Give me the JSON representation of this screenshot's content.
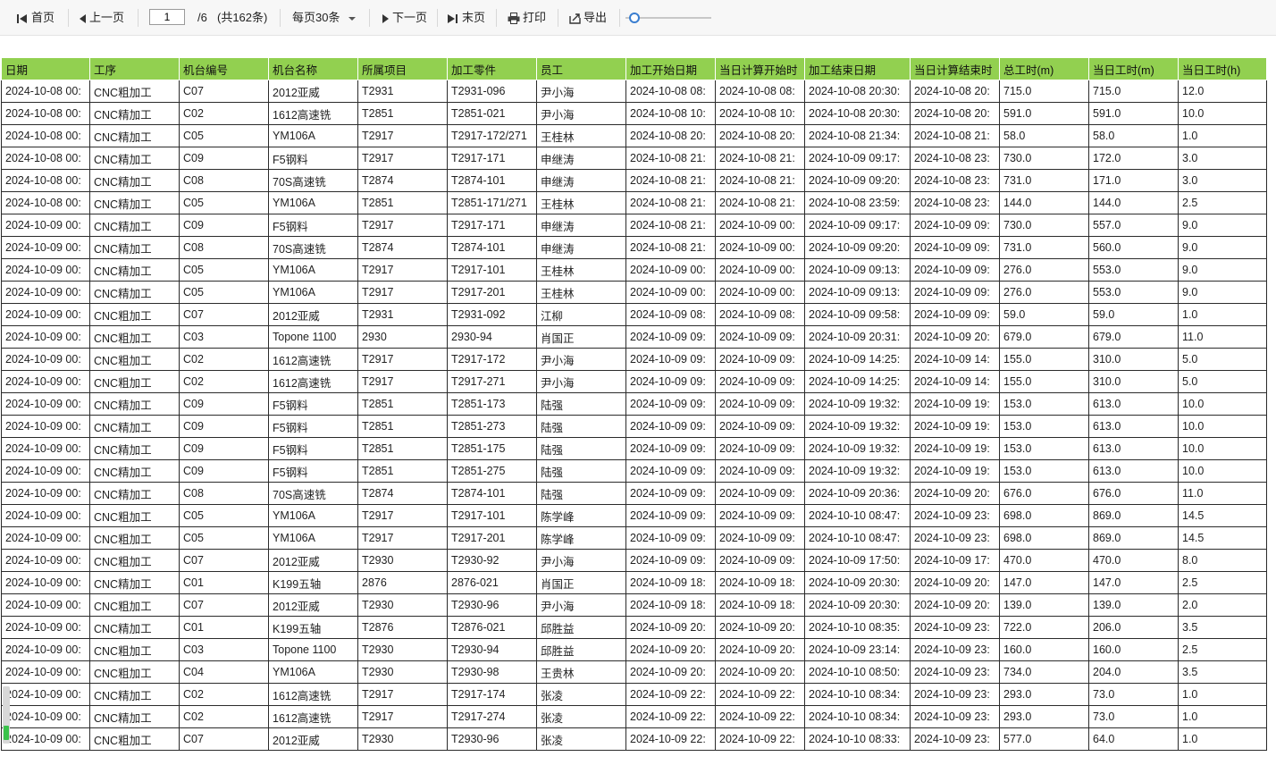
{
  "toolbar": {
    "first_label": "首页",
    "prev_label": "上一页",
    "page_current": "1",
    "page_total": "/6",
    "record_total": "(共162条)",
    "per_page": "每页30条",
    "next_label": "下一页",
    "last_label": "末页",
    "print_label": "打印",
    "export_label": "导出",
    "zoom_level": 0.05
  },
  "table": {
    "header_color": "#92d050",
    "columns": [
      "日期",
      "工序",
      "机台编号",
      "机台名称",
      "所属项目",
      "加工零件",
      "员工",
      "加工开始日期",
      "当日计算开始时",
      "加工结束日期",
      "当日计算结束时",
      "总工时(m)",
      "当日工时(m)",
      "当日工时(h)"
    ],
    "rows": [
      [
        "2024-10-08 00:",
        "CNC粗加工",
        "C07",
        "2012亚威",
        "T2931",
        "T2931-096",
        "尹小海",
        "2024-10-08 08:",
        "2024-10-08 08:",
        "2024-10-08 20:30:",
        "2024-10-08 20:",
        "715.0",
        "715.0",
        "12.0"
      ],
      [
        "2024-10-08 00:",
        "CNC精加工",
        "C02",
        "1612高速铣",
        "T2851",
        "T2851-021",
        "尹小海",
        "2024-10-08 10:",
        "2024-10-08 10:",
        "2024-10-08 20:30:",
        "2024-10-08 20:",
        "591.0",
        "591.0",
        "10.0"
      ],
      [
        "2024-10-08 00:",
        "CNC精加工",
        "C05",
        "YM106A",
        "T2917",
        "T2917-172/271",
        "王桂林",
        "2024-10-08 20:",
        "2024-10-08 20:",
        "2024-10-08 21:34:",
        "2024-10-08 21:",
        "58.0",
        "58.0",
        "1.0"
      ],
      [
        "2024-10-08 00:",
        "CNC精加工",
        "C09",
        "F5钢料",
        "T2917",
        "T2917-171",
        "申继涛",
        "2024-10-08 21:",
        "2024-10-08 21:",
        "2024-10-09 09:17:",
        "2024-10-08 23:",
        "730.0",
        "172.0",
        "3.0"
      ],
      [
        "2024-10-08 00:",
        "CNC精加工",
        "C08",
        "70S高速铣",
        "T2874",
        "T2874-101",
        "申继涛",
        "2024-10-08 21:",
        "2024-10-08 21:",
        "2024-10-09 09:20:",
        "2024-10-08 23:",
        "731.0",
        "171.0",
        "3.0"
      ],
      [
        "2024-10-08 00:",
        "CNC精加工",
        "C05",
        "YM106A",
        "T2851",
        "T2851-171/271",
        "王桂林",
        "2024-10-08 21:",
        "2024-10-08 21:",
        "2024-10-08 23:59:",
        "2024-10-08 23:",
        "144.0",
        "144.0",
        "2.5"
      ],
      [
        "2024-10-09 00:",
        "CNC精加工",
        "C09",
        "F5钢料",
        "T2917",
        "T2917-171",
        "申继涛",
        "2024-10-08 21:",
        "2024-10-09 00:",
        "2024-10-09 09:17:",
        "2024-10-09 09:",
        "730.0",
        "557.0",
        "9.0"
      ],
      [
        "2024-10-09 00:",
        "CNC精加工",
        "C08",
        "70S高速铣",
        "T2874",
        "T2874-101",
        "申继涛",
        "2024-10-08 21:",
        "2024-10-09 00:",
        "2024-10-09 09:20:",
        "2024-10-09 09:",
        "731.0",
        "560.0",
        "9.0"
      ],
      [
        "2024-10-09 00:",
        "CNC精加工",
        "C05",
        "YM106A",
        "T2917",
        "T2917-101",
        "王桂林",
        "2024-10-09 00:",
        "2024-10-09 00:",
        "2024-10-09 09:13:",
        "2024-10-09 09:",
        "276.0",
        "553.0",
        "9.0"
      ],
      [
        "2024-10-09 00:",
        "CNC精加工",
        "C05",
        "YM106A",
        "T2917",
        "T2917-201",
        "王桂林",
        "2024-10-09 00:",
        "2024-10-09 00:",
        "2024-10-09 09:13:",
        "2024-10-09 09:",
        "276.0",
        "553.0",
        "9.0"
      ],
      [
        "2024-10-09 00:",
        "CNC粗加工",
        "C07",
        "2012亚威",
        "T2931",
        "T2931-092",
        "江柳",
        "2024-10-09 08:",
        "2024-10-09 08:",
        "2024-10-09 09:58:",
        "2024-10-09 09:",
        "59.0",
        "59.0",
        "1.0"
      ],
      [
        "2024-10-09 00:",
        "CNC粗加工",
        "C03",
        "Topone 1100",
        "2930",
        "2930-94",
        "肖国正",
        "2024-10-09 09:",
        "2024-10-09 09:",
        "2024-10-09 20:31:",
        "2024-10-09 20:",
        "679.0",
        "679.0",
        "11.0"
      ],
      [
        "2024-10-09 00:",
        "CNC粗加工",
        "C02",
        "1612高速铣",
        "T2917",
        "T2917-172",
        "尹小海",
        "2024-10-09 09:",
        "2024-10-09 09:",
        "2024-10-09 14:25:",
        "2024-10-09 14:",
        "155.0",
        "310.0",
        "5.0"
      ],
      [
        "2024-10-09 00:",
        "CNC粗加工",
        "C02",
        "1612高速铣",
        "T2917",
        "T2917-271",
        "尹小海",
        "2024-10-09 09:",
        "2024-10-09 09:",
        "2024-10-09 14:25:",
        "2024-10-09 14:",
        "155.0",
        "310.0",
        "5.0"
      ],
      [
        "2024-10-09 00:",
        "CNC精加工",
        "C09",
        "F5钢料",
        "T2851",
        "T2851-173",
        "陆强",
        "2024-10-09 09:",
        "2024-10-09 09:",
        "2024-10-09 19:32:",
        "2024-10-09 19:",
        "153.0",
        "613.0",
        "10.0"
      ],
      [
        "2024-10-09 00:",
        "CNC精加工",
        "C09",
        "F5钢料",
        "T2851",
        "T2851-273",
        "陆强",
        "2024-10-09 09:",
        "2024-10-09 09:",
        "2024-10-09 19:32:",
        "2024-10-09 19:",
        "153.0",
        "613.0",
        "10.0"
      ],
      [
        "2024-10-09 00:",
        "CNC精加工",
        "C09",
        "F5钢料",
        "T2851",
        "T2851-175",
        "陆强",
        "2024-10-09 09:",
        "2024-10-09 09:",
        "2024-10-09 19:32:",
        "2024-10-09 19:",
        "153.0",
        "613.0",
        "10.0"
      ],
      [
        "2024-10-09 00:",
        "CNC精加工",
        "C09",
        "F5钢料",
        "T2851",
        "T2851-275",
        "陆强",
        "2024-10-09 09:",
        "2024-10-09 09:",
        "2024-10-09 19:32:",
        "2024-10-09 19:",
        "153.0",
        "613.0",
        "10.0"
      ],
      [
        "2024-10-09 00:",
        "CNC精加工",
        "C08",
        "70S高速铣",
        "T2874",
        "T2874-101",
        "陆强",
        "2024-10-09 09:",
        "2024-10-09 09:",
        "2024-10-09 20:36:",
        "2024-10-09 20:",
        "676.0",
        "676.0",
        "11.0"
      ],
      [
        "2024-10-09 00:",
        "CNC粗加工",
        "C05",
        "YM106A",
        "T2917",
        "T2917-101",
        "陈学峰",
        "2024-10-09 09:",
        "2024-10-09 09:",
        "2024-10-10 08:47:",
        "2024-10-09 23:",
        "698.0",
        "869.0",
        "14.5"
      ],
      [
        "2024-10-09 00:",
        "CNC粗加工",
        "C05",
        "YM106A",
        "T2917",
        "T2917-201",
        "陈学峰",
        "2024-10-09 09:",
        "2024-10-09 09:",
        "2024-10-10 08:47:",
        "2024-10-09 23:",
        "698.0",
        "869.0",
        "14.5"
      ],
      [
        "2024-10-09 00:",
        "CNC粗加工",
        "C07",
        "2012亚威",
        "T2930",
        "T2930-92",
        "尹小海",
        "2024-10-09 09:",
        "2024-10-09 09:",
        "2024-10-09 17:50:",
        "2024-10-09 17:",
        "470.0",
        "470.0",
        "8.0"
      ],
      [
        "2024-10-09 00:",
        "CNC精加工",
        "C01",
        "K199五轴",
        "2876",
        "2876-021",
        "肖国正",
        "2024-10-09 18:",
        "2024-10-09 18:",
        "2024-10-09 20:30:",
        "2024-10-09 20:",
        "147.0",
        "147.0",
        "2.5"
      ],
      [
        "2024-10-09 00:",
        "CNC粗加工",
        "C07",
        "2012亚威",
        "T2930",
        "T2930-96",
        "尹小海",
        "2024-10-09 18:",
        "2024-10-09 18:",
        "2024-10-09 20:30:",
        "2024-10-09 20:",
        "139.0",
        "139.0",
        "2.0"
      ],
      [
        "2024-10-09 00:",
        "CNC精加工",
        "C01",
        "K199五轴",
        "T2876",
        "T2876-021",
        "邱胜益",
        "2024-10-09 20:",
        "2024-10-09 20:",
        "2024-10-10 08:35:",
        "2024-10-09 23:",
        "722.0",
        "206.0",
        "3.5"
      ],
      [
        "2024-10-09 00:",
        "CNC粗加工",
        "C03",
        "Topone 1100",
        "T2930",
        "T2930-94",
        "邱胜益",
        "2024-10-09 20:",
        "2024-10-09 20:",
        "2024-10-09 23:14:",
        "2024-10-09 23:",
        "160.0",
        "160.0",
        "2.5"
      ],
      [
        "2024-10-09 00:",
        "CNC粗加工",
        "C04",
        "YM106A",
        "T2930",
        "T2930-98",
        "王贵林",
        "2024-10-09 20:",
        "2024-10-09 20:",
        "2024-10-10 08:50:",
        "2024-10-09 23:",
        "734.0",
        "204.0",
        "3.5"
      ],
      [
        "2024-10-09 00:",
        "CNC精加工",
        "C02",
        "1612高速铣",
        "T2917",
        "T2917-174",
        "张凌",
        "2024-10-09 22:",
        "2024-10-09 22:",
        "2024-10-10 08:34:",
        "2024-10-09 23:",
        "293.0",
        "73.0",
        "1.0"
      ],
      [
        "2024-10-09 00:",
        "CNC精加工",
        "C02",
        "1612高速铣",
        "T2917",
        "T2917-274",
        "张凌",
        "2024-10-09 22:",
        "2024-10-09 22:",
        "2024-10-10 08:34:",
        "2024-10-09 23:",
        "293.0",
        "73.0",
        "1.0"
      ],
      [
        "2024-10-09 00:",
        "CNC粗加工",
        "C07",
        "2012亚威",
        "T2930",
        "T2930-96",
        "张凌",
        "2024-10-09 22:",
        "2024-10-09 22:",
        "2024-10-10 08:33:",
        "2024-10-09 23:",
        "577.0",
        "64.0",
        "1.0"
      ]
    ]
  }
}
